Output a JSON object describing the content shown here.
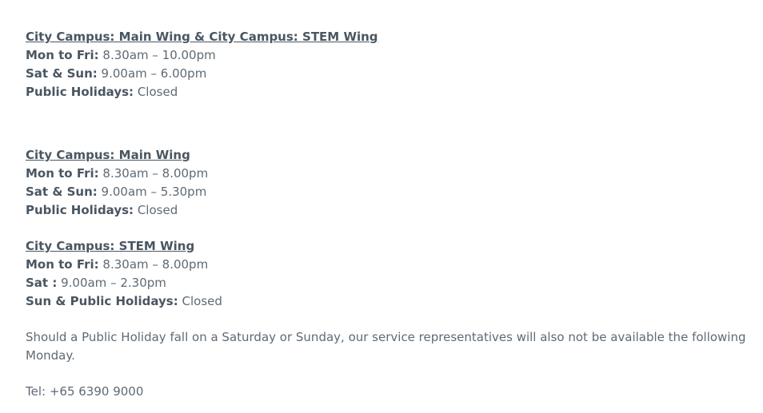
{
  "sections": [
    {
      "heading": "City Campus: Main Wing & City Campus: STEM Wing",
      "rows": [
        {
          "label": "Mon to Fri:",
          "value": " 8.30am – 10.00pm"
        },
        {
          "label": "Sat & Sun:",
          "value": " 9.00am – 6.00pm"
        },
        {
          "label": "Public Holidays:",
          "value": " Closed"
        }
      ]
    },
    {
      "heading": "City Campus: Main Wing",
      "rows": [
        {
          "label": "Mon to Fri:",
          "value": " 8.30am – 8.00pm"
        },
        {
          "label": "Sat & Sun:",
          "value": " 9.00am – 5.30pm"
        },
        {
          "label": "Public Holidays:",
          "value": " Closed"
        }
      ]
    },
    {
      "heading": "City Campus: STEM Wing",
      "rows": [
        {
          "label": "Mon to Fri:",
          "value": " 8.30am – 8.00pm"
        },
        {
          "label": "Sat :",
          "value": " 9.00am – 2.30pm"
        },
        {
          "label": "Sun & Public Holidays:",
          "value": " Closed"
        }
      ]
    }
  ],
  "note": "Should a Public Holiday fall on a Saturday or Sunday, our service representatives will also not be available the following Monday.",
  "tel": "Tel: +65 6390 9000"
}
